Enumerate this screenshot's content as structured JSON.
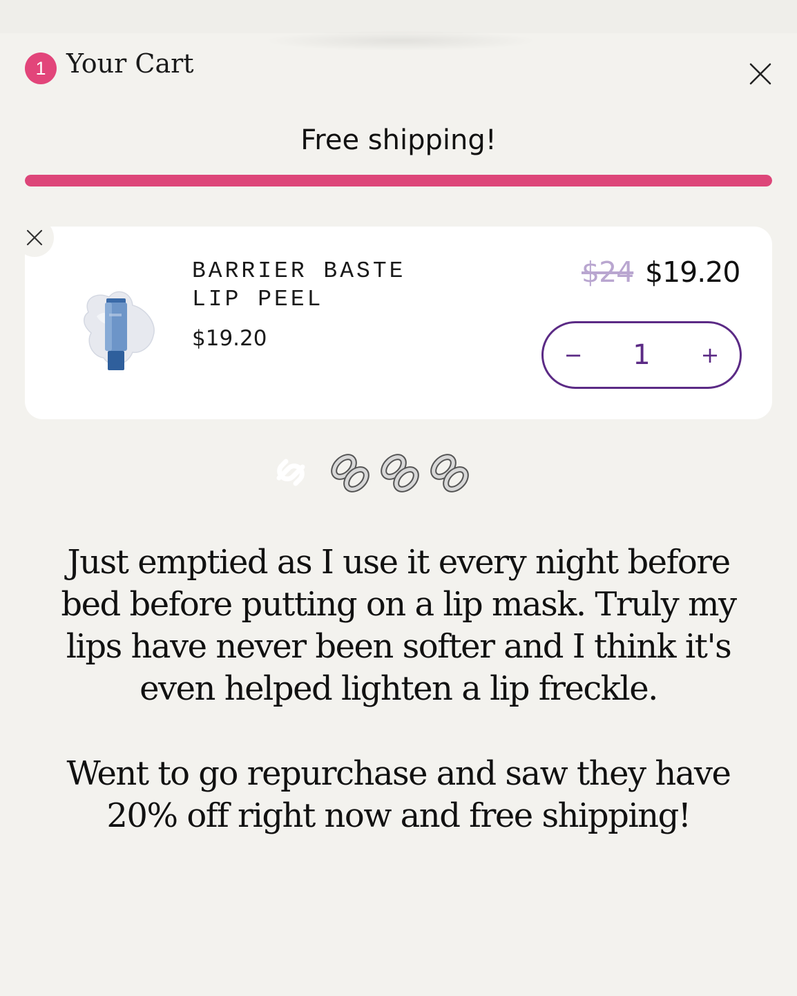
{
  "cart": {
    "count": "1",
    "title": "Your Cart",
    "close_icon": "close-icon"
  },
  "shipping": {
    "message": "Free shipping!",
    "progress": 1.0,
    "bar_color": "#dd4679"
  },
  "item": {
    "name": "BARRIER BASTE LIP PEEL",
    "price": "$19.20",
    "original_price": "$24",
    "sale_price": "$19.20",
    "quantity": "1",
    "minus_label": "−",
    "plus_label": "+",
    "remove_icon": "close-icon",
    "accent_color": "#5b2a85"
  },
  "decoration": {
    "emoji": "🔗🔗🔗🔗"
  },
  "review": {
    "paragraph1": "Just emptied as I use it every night before bed before putting on a lip mask. Truly my lips have never been softer and I think it's even helped lighten a lip freckle.",
    "paragraph2": "Went to go repurchase and saw they have 20% off right now and free shipping!"
  }
}
